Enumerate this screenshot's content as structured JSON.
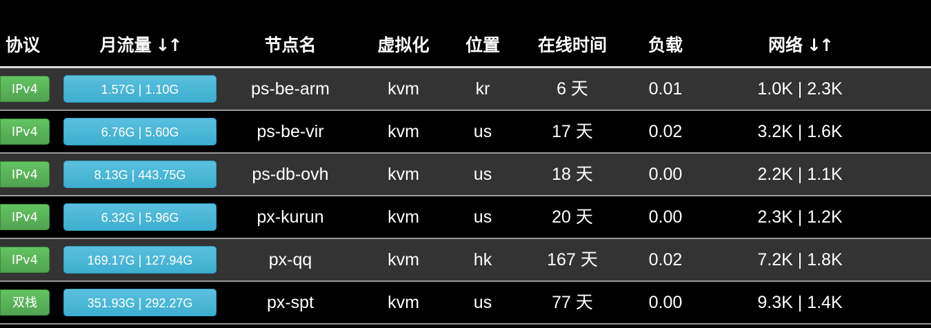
{
  "headers": {
    "protocol": "协议",
    "traffic": "月流量",
    "traffic_sort": "↓↑",
    "node": "节点名",
    "virt": "虚拟化",
    "location": "位置",
    "uptime": "在线时间",
    "load": "负载",
    "network": "网络",
    "network_sort": "↓↑"
  },
  "colors": {
    "protocol_badge": "#5cb85c",
    "traffic_bar": "#5bc0de",
    "row_odd": "#333333",
    "row_even": "#000000"
  },
  "rows": [
    {
      "protocol": "IPv4",
      "traffic": "1.57G | 1.10G",
      "node": "ps-be-arm",
      "virt": "kvm",
      "location": "kr",
      "uptime": "6 天",
      "load": "0.01",
      "network": "1.0K | 2.3K"
    },
    {
      "protocol": "IPv4",
      "traffic": "6.76G | 5.60G",
      "node": "ps-be-vir",
      "virt": "kvm",
      "location": "us",
      "uptime": "17 天",
      "load": "0.02",
      "network": "3.2K | 1.6K"
    },
    {
      "protocol": "IPv4",
      "traffic": "8.13G | 443.75G",
      "node": "ps-db-ovh",
      "virt": "kvm",
      "location": "us",
      "uptime": "18 天",
      "load": "0.00",
      "network": "2.2K | 1.1K"
    },
    {
      "protocol": "IPv4",
      "traffic": "6.32G | 5.96G",
      "node": "px-kurun",
      "virt": "kvm",
      "location": "us",
      "uptime": "20 天",
      "load": "0.00",
      "network": "2.3K | 1.2K"
    },
    {
      "protocol": "IPv4",
      "traffic": "169.17G | 127.94G",
      "node": "px-qq",
      "virt": "kvm",
      "location": "hk",
      "uptime": "167 天",
      "load": "0.02",
      "network": "7.2K | 1.8K"
    },
    {
      "protocol": "双栈",
      "traffic": "351.93G | 292.27G",
      "node": "px-spt",
      "virt": "kvm",
      "location": "us",
      "uptime": "77 天",
      "load": "0.00",
      "network": "9.3K | 1.4K"
    }
  ]
}
